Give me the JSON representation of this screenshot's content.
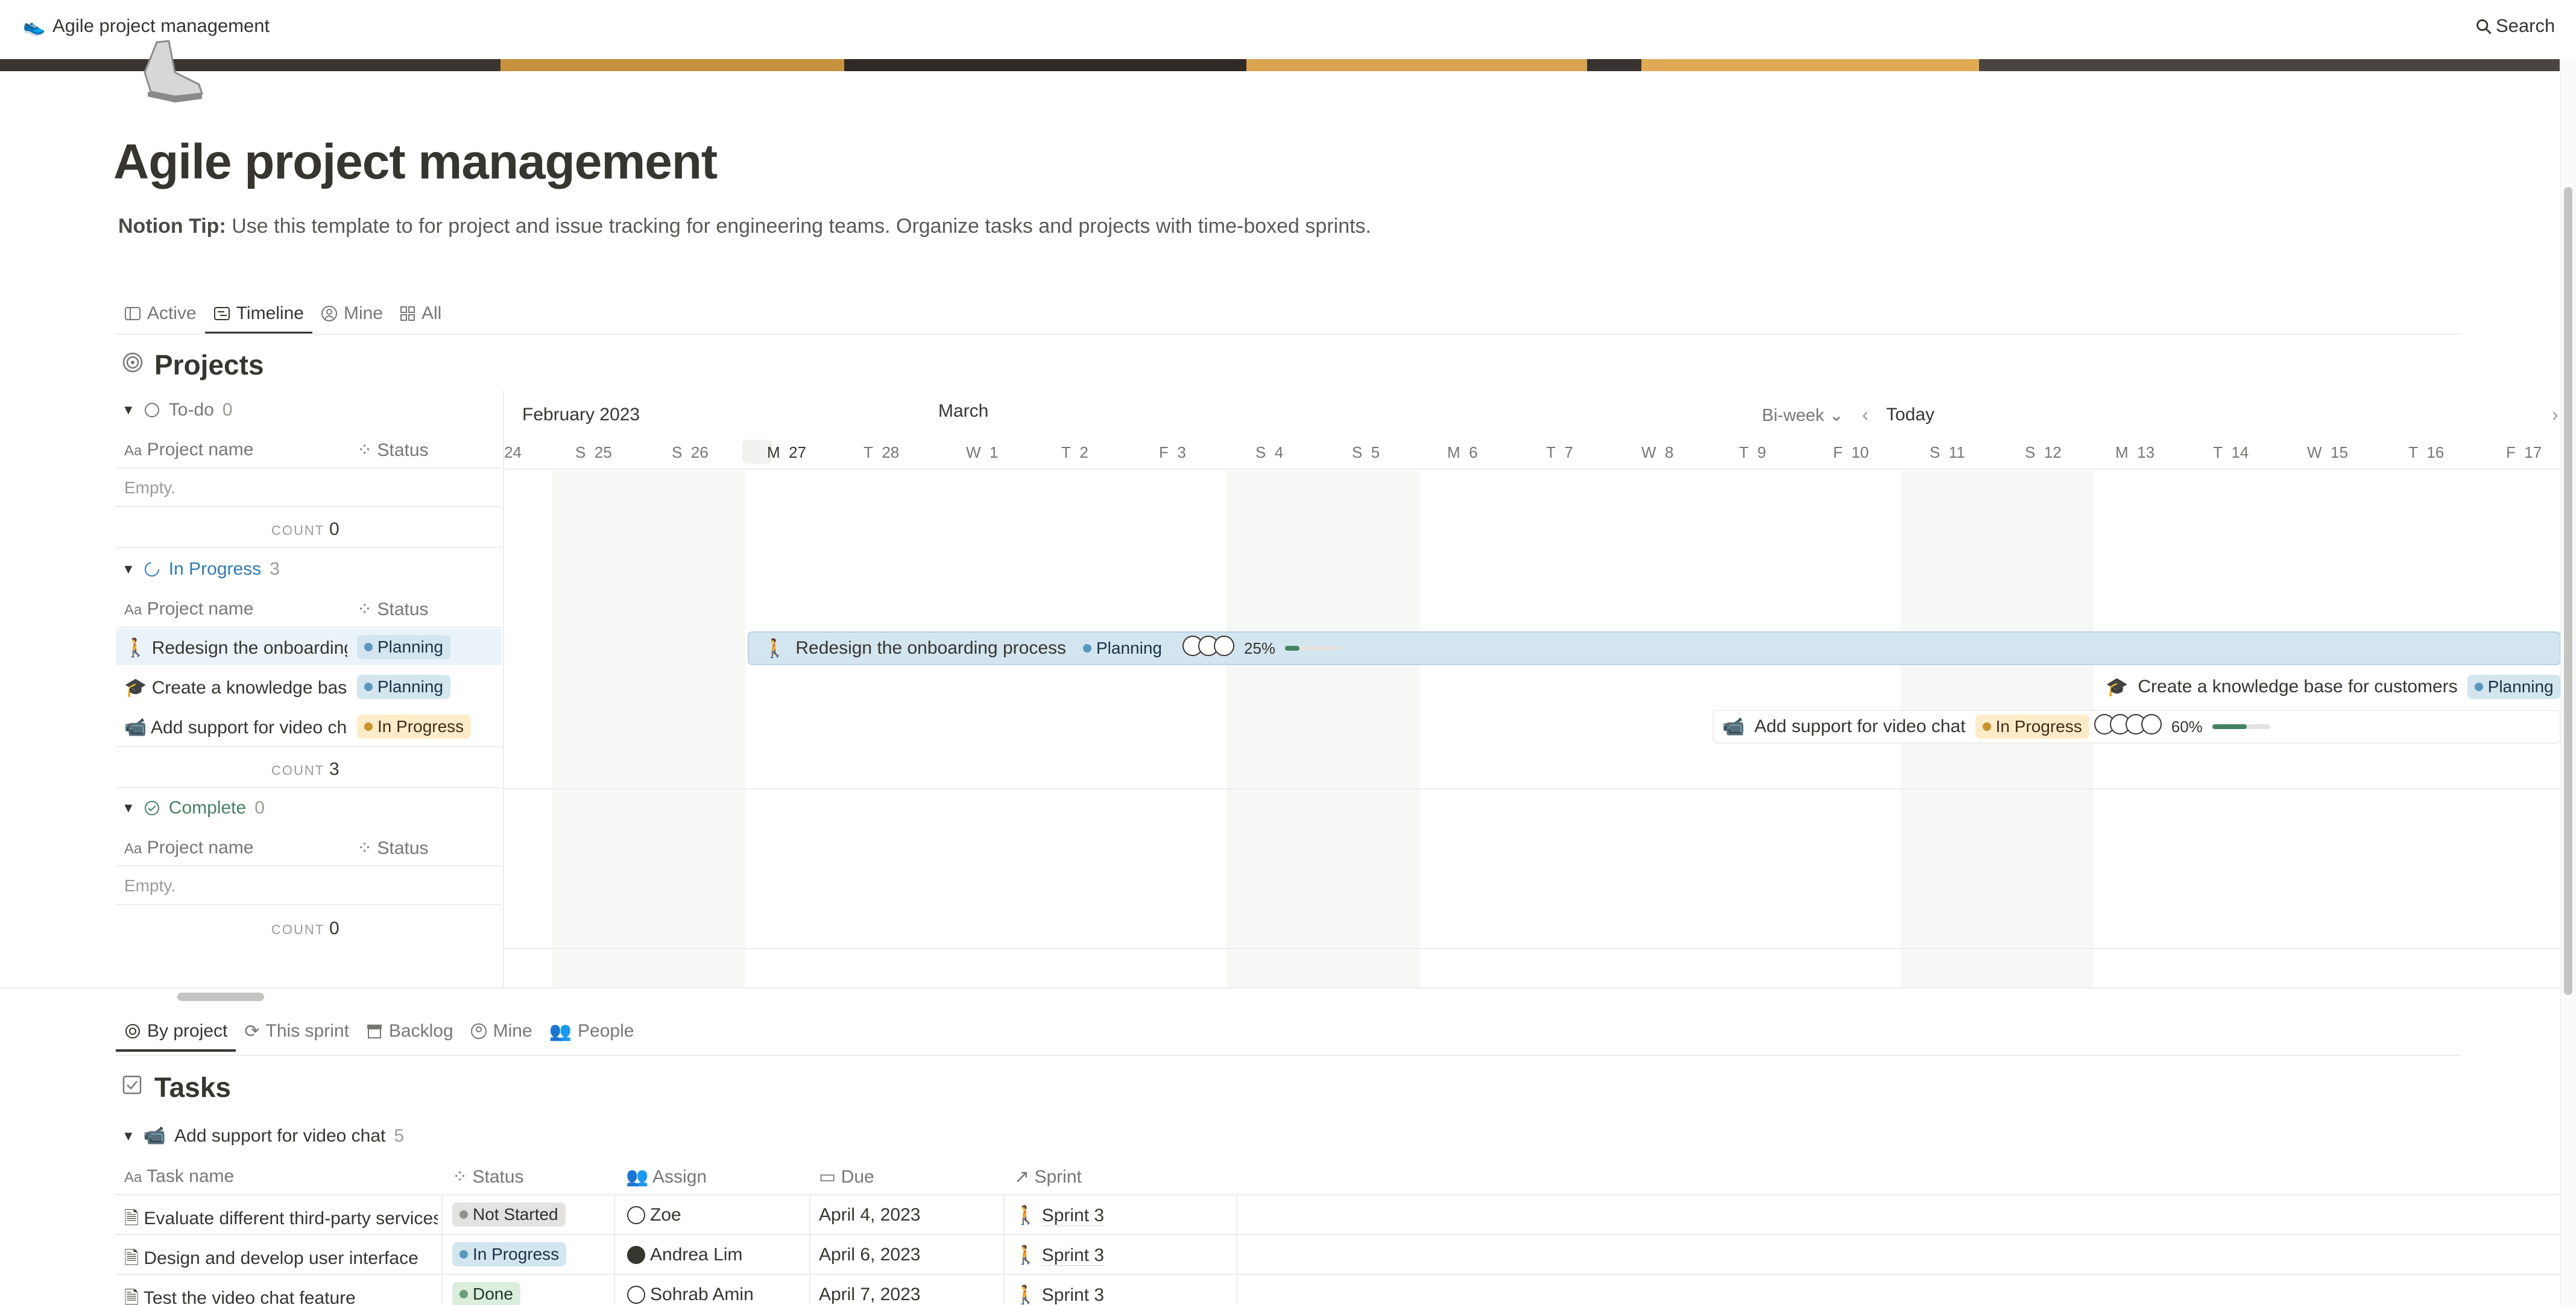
{
  "app": {
    "title": "Agile project management",
    "search_label": "Search"
  },
  "cover_colors": [
    "#3a3530",
    "#c8933f",
    "#2f2a26",
    "#d9a34f",
    "#383330",
    "#e0aa55",
    "#4a4540"
  ],
  "page": {
    "title": "Agile project management",
    "tip_label": "Notion Tip:",
    "tip_text": " Use this template to for project and issue tracking for engineering teams. Organize tasks and projects with time-boxed sprints."
  },
  "project_views": [
    {
      "label": "Active",
      "icon": "table-icon"
    },
    {
      "label": "Timeline",
      "icon": "timeline-icon",
      "active": true
    },
    {
      "label": "Mine",
      "icon": "person-icon"
    },
    {
      "label": "All",
      "icon": "gallery-icon"
    }
  ],
  "projects": {
    "title": "Projects",
    "col_name": "Project name",
    "col_status": "Status",
    "empty_label": "Empty.",
    "count_label": "COUNT",
    "groups": [
      {
        "label": "To-do",
        "count": "0",
        "color": "#787774",
        "total": "0",
        "items": []
      },
      {
        "label": "In Progress",
        "count": "3",
        "color": "#2e7cb8",
        "total": "3",
        "items": [
          {
            "name": "Redesign the onboarding process",
            "status": "Planning",
            "icon": "walk-icon"
          },
          {
            "name": "Create a knowledge base for customers",
            "status": "Planning",
            "icon": "graduation-cap-icon"
          },
          {
            "name": "Add support for video chat",
            "status": "In Progress",
            "icon": "video-camera-icon"
          }
        ]
      },
      {
        "label": "Complete",
        "count": "0",
        "color": "#448361",
        "total": "0",
        "items": []
      }
    ]
  },
  "timeline": {
    "month_feb": "February 2023",
    "month_mar": "March",
    "scale": "Bi-week",
    "today": "Today",
    "days": [
      {
        "w": "",
        "d": "24"
      },
      {
        "w": "S",
        "d": "25"
      },
      {
        "w": "S",
        "d": "26"
      },
      {
        "w": "M",
        "d": "27"
      },
      {
        "w": "T",
        "d": "28"
      },
      {
        "w": "W",
        "d": "1"
      },
      {
        "w": "T",
        "d": "2"
      },
      {
        "w": "F",
        "d": "3"
      },
      {
        "w": "S",
        "d": "4"
      },
      {
        "w": "S",
        "d": "5"
      },
      {
        "w": "M",
        "d": "6"
      },
      {
        "w": "T",
        "d": "7"
      },
      {
        "w": "W",
        "d": "8"
      },
      {
        "w": "T",
        "d": "9"
      },
      {
        "w": "F",
        "d": "10"
      },
      {
        "w": "S",
        "d": "11"
      },
      {
        "w": "S",
        "d": "12"
      },
      {
        "w": "M",
        "d": "13"
      },
      {
        "w": "T",
        "d": "14"
      },
      {
        "w": "W",
        "d": "15"
      },
      {
        "w": "T",
        "d": "16"
      },
      {
        "w": "F",
        "d": "17"
      }
    ],
    "bars": [
      {
        "name": "Redesign the onboarding process",
        "status": "Planning",
        "progress": "25%",
        "progress_value": 0.25
      },
      {
        "name": "Create a knowledge base for customers",
        "status": "Planning"
      },
      {
        "name": "Add support for video chat",
        "status": "In Progress",
        "progress": "60%",
        "progress_value": 0.6
      }
    ]
  },
  "task_views": [
    {
      "label": "By project",
      "icon": "target-icon",
      "active": true
    },
    {
      "label": "This sprint",
      "icon": "refresh-icon"
    },
    {
      "label": "Backlog",
      "icon": "archive-icon"
    },
    {
      "label": "Mine",
      "icon": "person-icon"
    },
    {
      "label": "People",
      "icon": "people-icon"
    }
  ],
  "tasks": {
    "title": "Tasks",
    "group_label": "Add support for video chat",
    "group_count": "5",
    "columns": {
      "name": "Task name",
      "status": "Status",
      "assign": "Assign",
      "due": "Due",
      "sprint": "Sprint"
    },
    "rows": [
      {
        "name": "Evaluate different third-party services",
        "status": "Not Started",
        "assign": "Zoe",
        "due": "April 4, 2023",
        "sprint": "Sprint 3"
      },
      {
        "name": "Design and develop user interface",
        "status": "In Progress",
        "assign": "Andrea Lim",
        "due": "April 6, 2023",
        "sprint": "Sprint 3"
      },
      {
        "name": "Test the video chat feature",
        "status": "Done",
        "assign": "Sohrab Amin",
        "due": "April 7, 2023",
        "sprint": "Sprint 3"
      }
    ]
  }
}
